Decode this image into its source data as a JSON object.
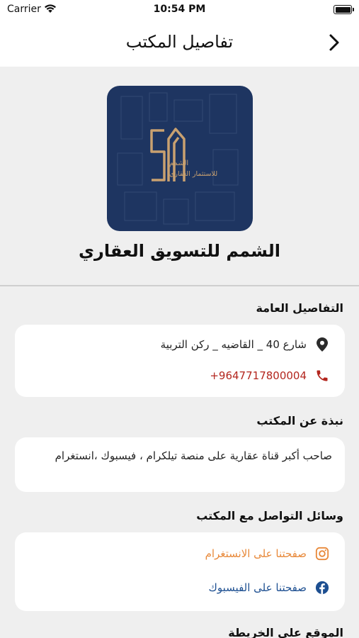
{
  "status_bar": {
    "carrier": "Carrier",
    "time": "10:54 PM"
  },
  "nav": {
    "title": "تفاصيل المكتب",
    "back_icon": "chevron-right-icon"
  },
  "office": {
    "name": "الشمم للتسويق العقاري",
    "logo": {
      "text_line1": "الشمم",
      "text_line2": "للاستثمار العقاري",
      "bg_color": "#1e3561",
      "accent_color": "#c9a170"
    }
  },
  "general": {
    "title": "التفاصيل العامة",
    "address": "شارع 40 _ القاضيه _ ركن التربية",
    "phone": "+9647717800004",
    "phone_color": "#b3261e"
  },
  "about": {
    "title": "نبذة عن المكتب",
    "text": "صاحب أكبر قناة عقارية على منصة تيلكرام ، فيسبوك ،انستغرام"
  },
  "social": {
    "title": "وسائل التواصل مع المكتب",
    "instagram_label": "صفحتنا على الانستغرام",
    "facebook_label": "صفحتنا على الفيسبوك",
    "instagram_color": "#e8893a",
    "facebook_color": "#1d4f91"
  },
  "map": {
    "title": "الموقع على الخريطة"
  }
}
